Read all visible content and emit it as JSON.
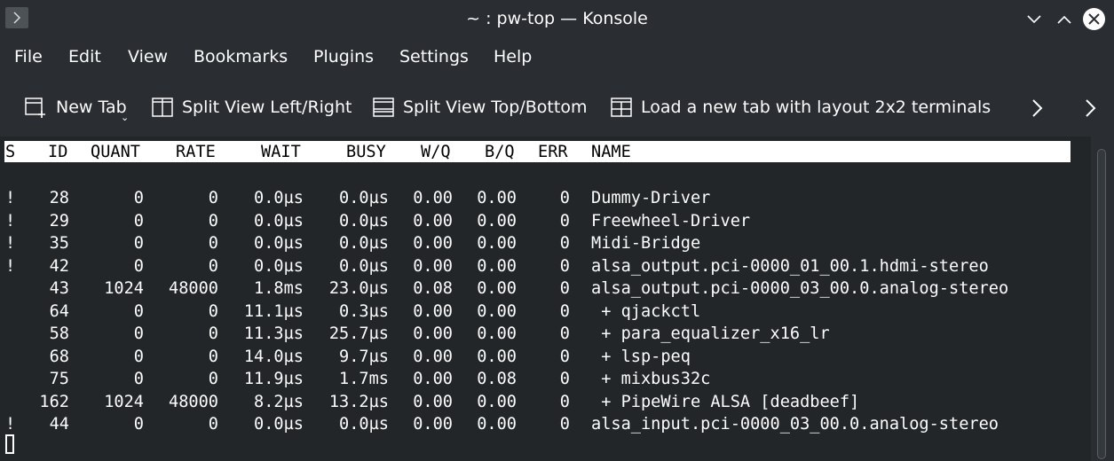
{
  "window": {
    "title": "~ : pw-top — Konsole"
  },
  "menubar": {
    "items": [
      "File",
      "Edit",
      "View",
      "Bookmarks",
      "Plugins",
      "Settings",
      "Help"
    ]
  },
  "toolbar": {
    "new_tab": "New Tab",
    "split_lr": "Split View Left/Right",
    "split_tb": "Split View Top/Bottom",
    "layout_2x2": "Load a new tab with layout 2x2 terminals"
  },
  "terminal": {
    "headers": [
      "S",
      "ID",
      "QUANT",
      "RATE",
      "WAIT",
      "BUSY",
      "W/Q",
      "B/Q",
      "ERR",
      "NAME"
    ],
    "rows": [
      [
        "!",
        "28",
        "0",
        "0",
        "0.0µs",
        "0.0µs",
        "0.00",
        "0.00",
        "0",
        "Dummy-Driver"
      ],
      [
        "!",
        "29",
        "0",
        "0",
        "0.0µs",
        "0.0µs",
        "0.00",
        "0.00",
        "0",
        "Freewheel-Driver"
      ],
      [
        "!",
        "35",
        "0",
        "0",
        "0.0µs",
        "0.0µs",
        "0.00",
        "0.00",
        "0",
        "Midi-Bridge"
      ],
      [
        "!",
        "42",
        "0",
        "0",
        "0.0µs",
        "0.0µs",
        "0.00",
        "0.00",
        "0",
        "alsa_output.pci-0000_01_00.1.hdmi-stereo"
      ],
      [
        "",
        "43",
        "1024",
        "48000",
        "1.8ms",
        "23.0µs",
        "0.08",
        "0.00",
        "0",
        "alsa_output.pci-0000_03_00.0.analog-stereo"
      ],
      [
        "",
        "64",
        "0",
        "0",
        "11.1µs",
        "0.3µs",
        "0.00",
        "0.00",
        "0",
        " + qjackctl"
      ],
      [
        "",
        "58",
        "0",
        "0",
        "11.3µs",
        "25.7µs",
        "0.00",
        "0.00",
        "0",
        " + para_equalizer_x16_lr"
      ],
      [
        "",
        "68",
        "0",
        "0",
        "14.0µs",
        "9.7µs",
        "0.00",
        "0.00",
        "0",
        " + lsp-peq"
      ],
      [
        "",
        "75",
        "0",
        "0",
        "11.9µs",
        "1.7ms",
        "0.00",
        "0.08",
        "0",
        " + mixbus32c"
      ],
      [
        "",
        "162",
        "1024",
        "48000",
        "8.2µs",
        "13.2µs",
        "0.00",
        "0.00",
        "0",
        " + PipeWire ALSA [deadbeef]"
      ],
      [
        "!",
        "44",
        "0",
        "0",
        "0.0µs",
        "0.0µs",
        "0.00",
        "0.00",
        "0",
        "alsa_input.pci-0000_03_00.0.analog-stereo"
      ]
    ]
  }
}
